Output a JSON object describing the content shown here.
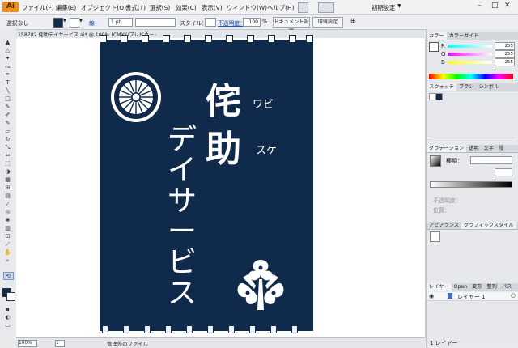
{
  "app": {
    "logo": "Ai"
  },
  "menu": [
    "ファイル(F)",
    "編集(E)",
    "オブジェクト(O)",
    "書式(T)",
    "選択(S)",
    "効果(C)",
    "表示(V)",
    "ウィンドウ(W)",
    "ヘルプ(H)"
  ],
  "workspace": {
    "label": "初期設定"
  },
  "control": {
    "selection": "選択なし",
    "stroke_label": "線：",
    "stroke_weight": "1 pt",
    "style_label": "スタイル：",
    "opacity_label": "不透明度：",
    "opacity_value": "100",
    "opacity_unit": "%",
    "document_setup": "ドキュメント設定",
    "preferences": "環境設定"
  },
  "document": {
    "tab_title": "158782 侘助デイサービス.ai* @ 100% (CMYK/プレビュー)"
  },
  "artwork": {
    "title_kanji_1": "侘",
    "title_kanji_2": "助",
    "reading_1": "ワビ",
    "reading_2": "スケ",
    "subtitle": "デイサービス",
    "bg_color": "#0f2a4a"
  },
  "panels": {
    "color": {
      "tabs": [
        "カラー",
        "カラーガイド"
      ],
      "values": [
        "255",
        "255",
        "255"
      ],
      "channels": [
        "R",
        "G",
        "B"
      ]
    },
    "swatch": {
      "tabs": [
        "スウォッチ",
        "ブラシ",
        "シンボル"
      ]
    },
    "gradient": {
      "tabs": [
        "グラデーション",
        "透明",
        "文字",
        "段"
      ],
      "type_label": "種類：",
      "angle_label": "不透明度：",
      "location_label": "位置："
    },
    "appearance": {
      "tabs": [
        "アピアランス",
        "グラフィックスタイル"
      ]
    },
    "layers": {
      "tabs": [
        "レイヤー",
        "Open",
        "変形",
        "整列",
        "パス"
      ],
      "layer_name": "レイヤー 1",
      "count": "1 レイヤー"
    }
  },
  "status": {
    "zoom": "100%",
    "page": "1",
    "status_text": "管理外のファイル"
  }
}
